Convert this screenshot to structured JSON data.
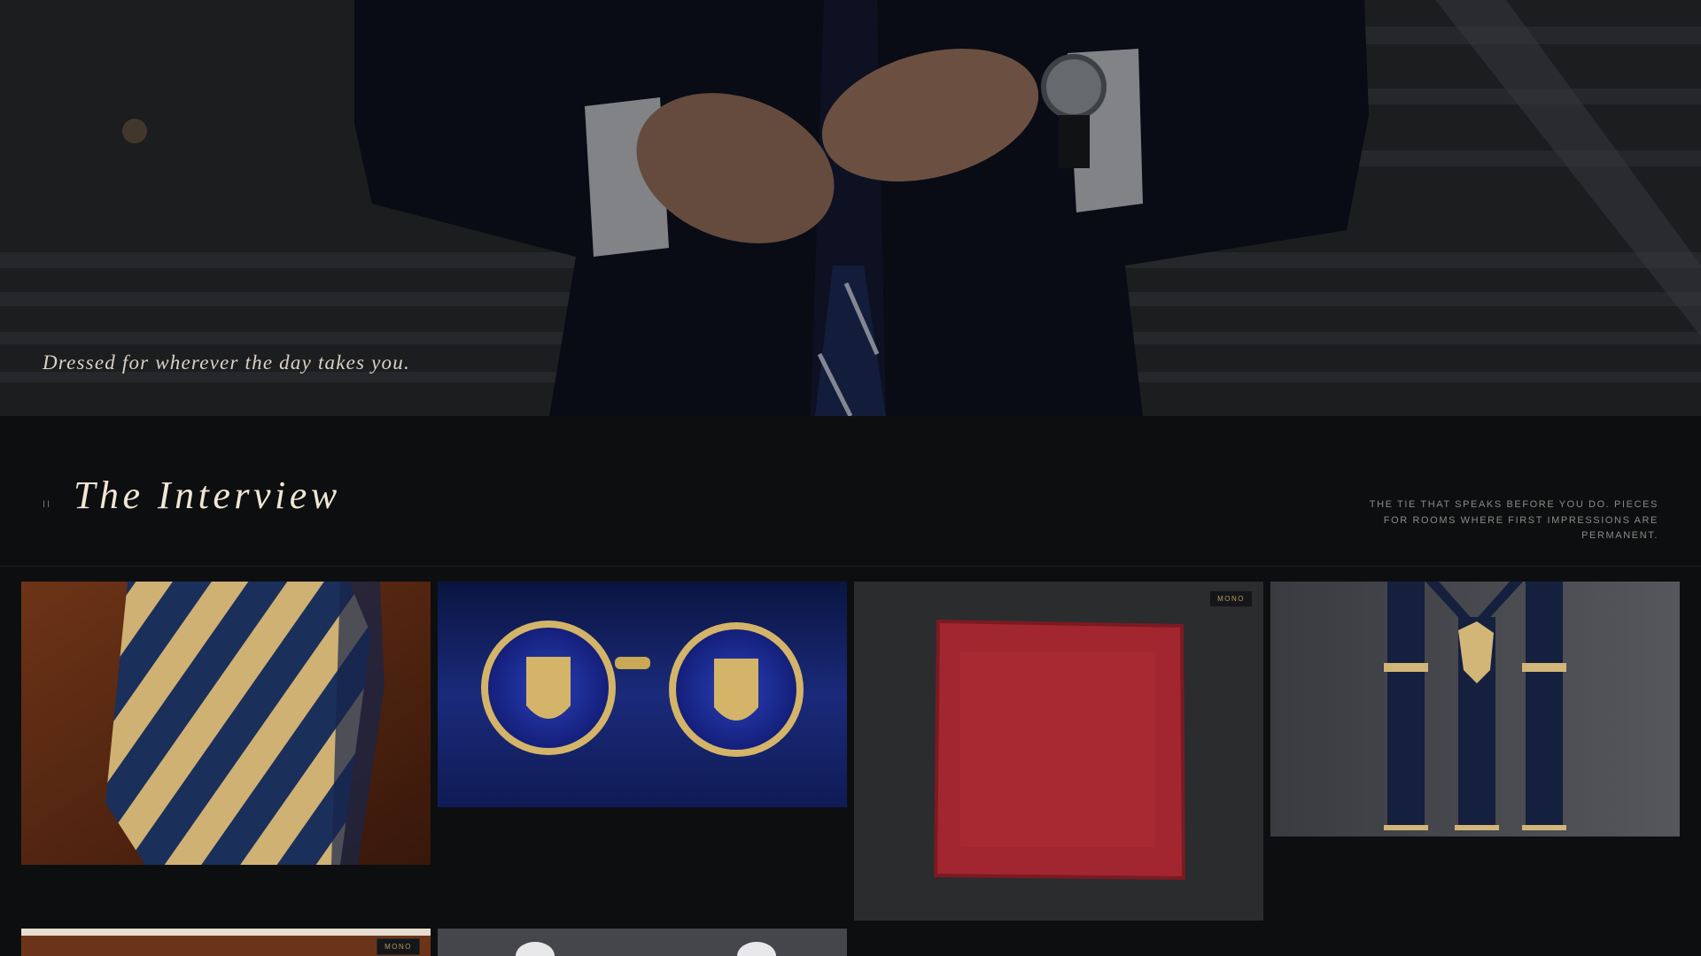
{
  "hero": {
    "caption": "Dressed for wherever the day takes you."
  },
  "section": {
    "number": "II",
    "title": "The Interview",
    "tagline": "The tie that speaks before you do. Pieces for rooms where first impressions are permanent."
  },
  "products": [
    {
      "name": "Striped silk tie",
      "badge": ""
    },
    {
      "name": "Crest cufflinks",
      "badge": ""
    },
    {
      "name": "Red pocket square",
      "badge": "MONO"
    },
    {
      "name": "Navy braces",
      "badge": ""
    },
    {
      "name": "Leather item",
      "badge": "MONO"
    },
    {
      "name": "White shirt",
      "badge": ""
    }
  ],
  "colors": {
    "background": "#0d0e10",
    "accent_gold": "#b59b5e",
    "title": "#efe6d4"
  }
}
